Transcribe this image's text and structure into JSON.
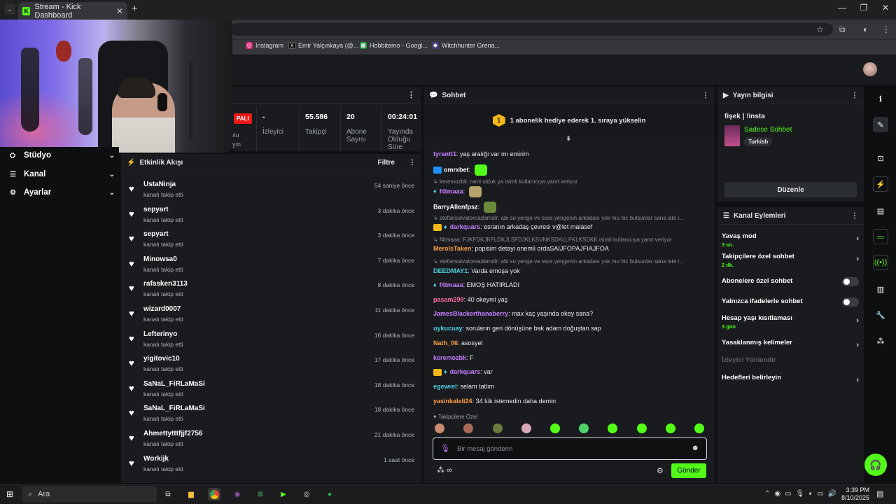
{
  "browser": {
    "tab_title": "Stream - Kick Dashboard",
    "tab_favicon": "K",
    "bookmarks": [
      "Instagram",
      "Emir Yalçınkaya (@...",
      "Hobbitemo - Googl...",
      "Witchhunter Grena..."
    ]
  },
  "nav": {
    "items": [
      {
        "label": "Stüdyo",
        "icon": "studio-icon"
      },
      {
        "label": "Kanal",
        "icon": "channel-icon"
      },
      {
        "label": "Ayarlar",
        "icon": "gear-icon"
      }
    ]
  },
  "stats": {
    "live_badge": "PALI",
    "live_partial": "ılu",
    "live_partial2": "yın",
    "viewers_value": "-",
    "viewers_label": "İzleyici",
    "followers_value": "55.586",
    "followers_label": "Takipçi",
    "subs_value": "20",
    "subs_label_1": "Abone",
    "subs_label_2": "Sayısı",
    "uptime_value": "00:24:01",
    "uptime_label_1": "Yayında",
    "uptime_label_2": "Olduğu",
    "uptime_label_3": "Süre"
  },
  "feed": {
    "title": "Etkinlik Akışı",
    "filter": "Filtre",
    "rows": [
      {
        "name": "UstaNinja",
        "action": "kanalı takip etti",
        "time": "54 saniye önce"
      },
      {
        "name": "sepyart",
        "action": "kanalı takip etti",
        "time": "3 dakika önce"
      },
      {
        "name": "sepyart",
        "action": "kanalı takip etti",
        "time": "3 dakika önce"
      },
      {
        "name": "Minowsa0",
        "action": "kanalı takip etti",
        "time": "7 dakika önce"
      },
      {
        "name": "rafasken3113",
        "action": "kanalı takip etti",
        "time": "8 dakika önce"
      },
      {
        "name": "wizard0007",
        "action": "kanalı takip etti",
        "time": "11 dakika önce"
      },
      {
        "name": "Lefterinyo",
        "action": "kanalı takip etti",
        "time": "16 dakika önce"
      },
      {
        "name": "yigitovic10",
        "action": "kanalı takip etti",
        "time": "17 dakika önce"
      },
      {
        "name": "SaNaL_FiRLaMaSi",
        "action": "kanalı takip etti",
        "time": "18 dakika önce"
      },
      {
        "name": "SaNaL_FiRLaMaSi",
        "action": "kanalı takip etti",
        "time": "18 dakika önce"
      },
      {
        "name": "Ahmettytttfjjf2756",
        "action": "kanalı takip etti",
        "time": "21 dakika önce"
      },
      {
        "name": "Workijk",
        "action": "kanalı takip etti",
        "time": "1 saat önce"
      }
    ]
  },
  "chat": {
    "title": "Sohbet",
    "pinned": "1 abonelik hediye ederek 1. sıraya yükselin",
    "pinned_rank": "1",
    "messages": [
      {
        "user": "tyrantt1",
        "color": "#c77dff",
        "text": "yaş aralığı var mı emirim"
      },
      {
        "user": "omrxbet",
        "color": "#ffffff",
        "text": ""
      },
      {
        "reply": "keremozbk: rami olduk ya isimli kullanıcıya yanıt veriyor"
      },
      {
        "user": "f4tmaaa",
        "color": "#c77dff",
        "text": ""
      },
      {
        "user": "BarryAllenfpsz",
        "color": "#ffffff",
        "text": ""
      },
      {
        "reply": "stefansalvatoreadamdir: abi su yenge ve esra yengenin arkadası yok mu hic bulsunlar sana iste i..."
      },
      {
        "user": "darkquars",
        "color": "#c77dff",
        "text": "esranın arkadaş çevresi v@let malasef"
      },
      {
        "reply": "f4tmaaa: FJKFDKJKFLDKJLSFDJKLKSVNKSDKLLFKLKSDKK isimli kullanıcıya yanıt veriyor"
      },
      {
        "user": "MerolsTaken",
        "color": "#ff9f43",
        "text": "popisim detayi onemli ordaSAIJFOPAJFIAJFOA"
      },
      {
        "reply": "stefansalvatoreadamdir: abi su yenge ve esra yengenin arkadası yok mu hic bulsunlar sana iste i..."
      },
      {
        "user": "DEEDMAY1",
        "color": "#4dd0e1",
        "text": "Varda emoşa yok"
      },
      {
        "user": "f4tmaaa",
        "color": "#c77dff",
        "text": "EMOŞ HATIRLADI"
      },
      {
        "user": "pasam299",
        "color": "#ff6b9d",
        "text": "40 okeymi yaş"
      },
      {
        "user": "JamesBlackerthanaberry",
        "color": "#c77dff",
        "text": "max kaç yaşında okey sana?"
      },
      {
        "user": "uykucuay",
        "color": "#4dd0e1",
        "text": "soruların geri dönüşüne bak adam doğuştan sap"
      },
      {
        "user": "Nath_06",
        "color": "#ff9f43",
        "text": "asosyel"
      },
      {
        "user": "keremozbk",
        "color": "#c77dff",
        "text": "F"
      },
      {
        "user": "darkquars",
        "color": "#c77dff",
        "text": "var"
      },
      {
        "user": "egewrel",
        "color": "#4dd0e1",
        "text": "selam tatlım"
      },
      {
        "user": "yasinkaleli24",
        "color": "#ff9f43",
        "text": "34 lük istemedin daha demin"
      }
    ],
    "followers_only": "Takipçilere Özel",
    "input_placeholder": "Bir mesaj gönderin",
    "send_label": "Gönder"
  },
  "info": {
    "title": "Yayın bilgisi",
    "stream_title": "fişek | !insta",
    "category": "Sadece Sohbet",
    "language": "Turkish",
    "edit_label": "Düzenle"
  },
  "actions": {
    "title": "Kanal Eylemleri",
    "items": [
      {
        "label": "Yavaş mod",
        "sub": "3 sn."
      },
      {
        "label": "Takipçilere özel sohbet",
        "sub": "2 dk."
      },
      {
        "label": "Abonelere özel sohbet",
        "toggle": false
      },
      {
        "label": "Yalnızca ifadelerle sohbet",
        "toggle": false
      },
      {
        "label": "Hesap yaşı kısıtlaması",
        "sub": "3 gün"
      },
      {
        "label": "Yasaklanmış kelimeler"
      },
      {
        "label": "İzleyici Yönlendir",
        "disabled": true
      },
      {
        "label": "Hedefleri belirleyin"
      }
    ]
  },
  "taskbar": {
    "search": "Ara",
    "time": "3:39 PM",
    "date": "8/10/2025"
  },
  "colors": {
    "accent": "#53fc18",
    "panel": "#191b1f",
    "bg": "#0e0f10"
  }
}
